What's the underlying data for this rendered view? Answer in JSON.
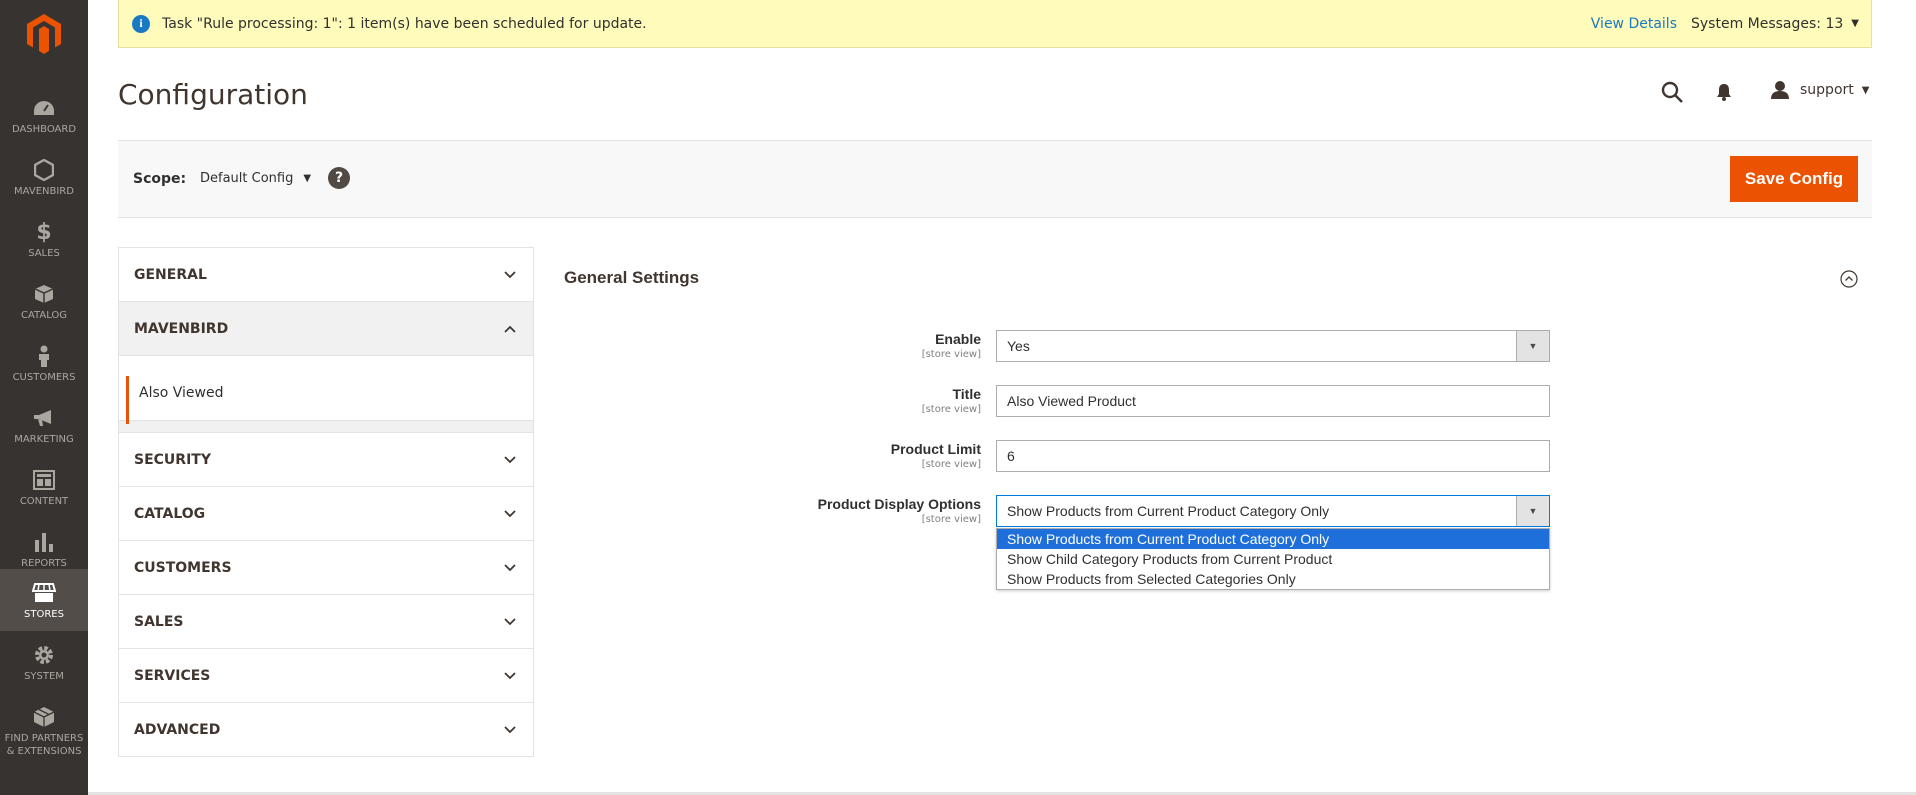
{
  "sidebar": {
    "items": [
      {
        "label": "DASHBOARD",
        "icon": "dashboard-icon"
      },
      {
        "label": "MAVENBIRD",
        "icon": "hexagon-icon"
      },
      {
        "label": "SALES",
        "icon": "dollar-icon"
      },
      {
        "label": "CATALOG",
        "icon": "box-icon"
      },
      {
        "label": "CUSTOMERS",
        "icon": "person-icon"
      },
      {
        "label": "MARKETING",
        "icon": "megaphone-icon"
      },
      {
        "label": "CONTENT",
        "icon": "layout-icon"
      },
      {
        "label": "REPORTS",
        "icon": "bar-chart-icon"
      },
      {
        "label": "STORES",
        "icon": "store-icon"
      },
      {
        "label": "SYSTEM",
        "icon": "gear-icon"
      },
      {
        "label": "FIND PARTNERS & EXTENSIONS",
        "icon": "extensions-icon"
      }
    ],
    "active": "STORES"
  },
  "notice": {
    "message": "Task \"Rule processing: 1\": 1 item(s) have been scheduled for update.",
    "view_details": "View Details",
    "system_messages": "System Messages: 13"
  },
  "header": {
    "title": "Configuration",
    "user": "support"
  },
  "scope": {
    "label": "Scope:",
    "value": "Default Config",
    "help": "?",
    "save_label": "Save Config"
  },
  "tabs": [
    {
      "label": "GENERAL"
    },
    {
      "label": "MAVENBIRD",
      "sub": "Also Viewed"
    },
    {
      "label": "SECURITY"
    },
    {
      "label": "CATALOG"
    },
    {
      "label": "CUSTOMERS"
    },
    {
      "label": "SALES"
    },
    {
      "label": "SERVICES"
    },
    {
      "label": "ADVANCED"
    }
  ],
  "section": {
    "title": "General Settings",
    "fields": [
      {
        "label": "Enable",
        "scope": "[store view]",
        "value": "Yes"
      },
      {
        "label": "Title",
        "scope": "[store view]",
        "value": "Also Viewed Product"
      },
      {
        "label": "Product Limit",
        "scope": "[store view]",
        "value": "6"
      },
      {
        "label": "Product Display Options",
        "scope": "[store view]",
        "value": "Show Products from Current Product Category Only"
      }
    ],
    "display_options": [
      "Show Products from Current Product Category Only",
      "Show Child Category Products from Current Product",
      "Show Products from Selected Categories Only"
    ]
  },
  "colors": {
    "accent": "#eb5202",
    "sidebar": "#373330",
    "link": "#1979c3",
    "notice_bg": "#fffbbb"
  }
}
